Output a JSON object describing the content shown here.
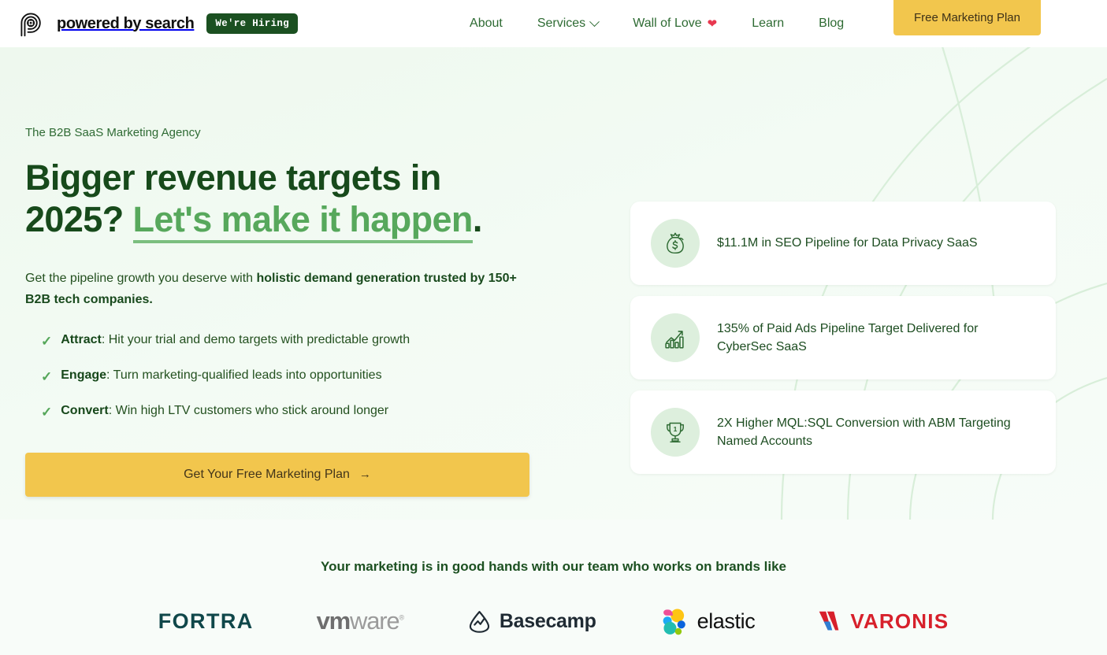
{
  "header": {
    "brand_name": "powered by search",
    "logo_icon": "fingerprint-gear-logo",
    "hiring_badge": "We're Hiring",
    "nav": [
      {
        "label": "About",
        "icon": null
      },
      {
        "label": "Services",
        "icon": "chevron-down-icon"
      },
      {
        "label": "Wall of Love",
        "icon": "heart-icon"
      },
      {
        "label": "Learn",
        "icon": null
      },
      {
        "label": "Blog",
        "icon": null
      }
    ],
    "cta_label": "Free Marketing Plan"
  },
  "hero": {
    "eyebrow": "The B2B SaaS Marketing Agency",
    "headline_part1": "Bigger revenue targets in 2025? ",
    "headline_highlight": "Let's make it happen",
    "headline_part2": ".",
    "subhead_plain1": "Get the pipeline growth you deserve with ",
    "subhead_bold": "holistic demand generation trusted by 150+ B2B tech companies.",
    "benefits": [
      {
        "term": "Attract",
        "rest": ": Hit your trial and demo targets with predictable growth",
        "icon": "check-icon"
      },
      {
        "term": "Engage",
        "rest": ": Turn marketing-qualified leads into opportunities",
        "icon": "check-icon"
      },
      {
        "term": "Convert",
        "rest": ": Win high LTV customers who stick around longer",
        "icon": "check-icon"
      }
    ],
    "cta_label": "Get Your Free Marketing Plan",
    "cta_arrow": "→",
    "result_cards": [
      {
        "icon": "money-bag-icon",
        "text": "$11.1M in SEO Pipeline for Data Privacy SaaS"
      },
      {
        "icon": "bar-chart-growth-icon",
        "text": "135% of Paid Ads Pipeline Target Delivered for CyberSec SaaS"
      },
      {
        "icon": "trophy-icon",
        "text": "2X Higher MQL:SQL Conversion with ABM Targeting Named Accounts"
      }
    ]
  },
  "logos": {
    "title": "Your marketing is in good hands with our team who works on brands like",
    "items": [
      {
        "name": "FORTRA",
        "icon": "fortra-logo"
      },
      {
        "name": "vmware",
        "icon": "vmware-logo"
      },
      {
        "name": "Basecamp",
        "icon": "basecamp-logo"
      },
      {
        "name": "elastic",
        "icon": "elastic-logo"
      },
      {
        "name": "VARONIS",
        "icon": "varonis-logo"
      }
    ]
  },
  "colors": {
    "brand_green_dark": "#174a1b",
    "brand_green_mid": "#2e6b33",
    "brand_green_light": "#57a85c",
    "accent_yellow": "#f2c64d",
    "hero_bg": "#f3fbf4",
    "badge_green": "#1b5021",
    "heart_red": "#e8384f"
  }
}
